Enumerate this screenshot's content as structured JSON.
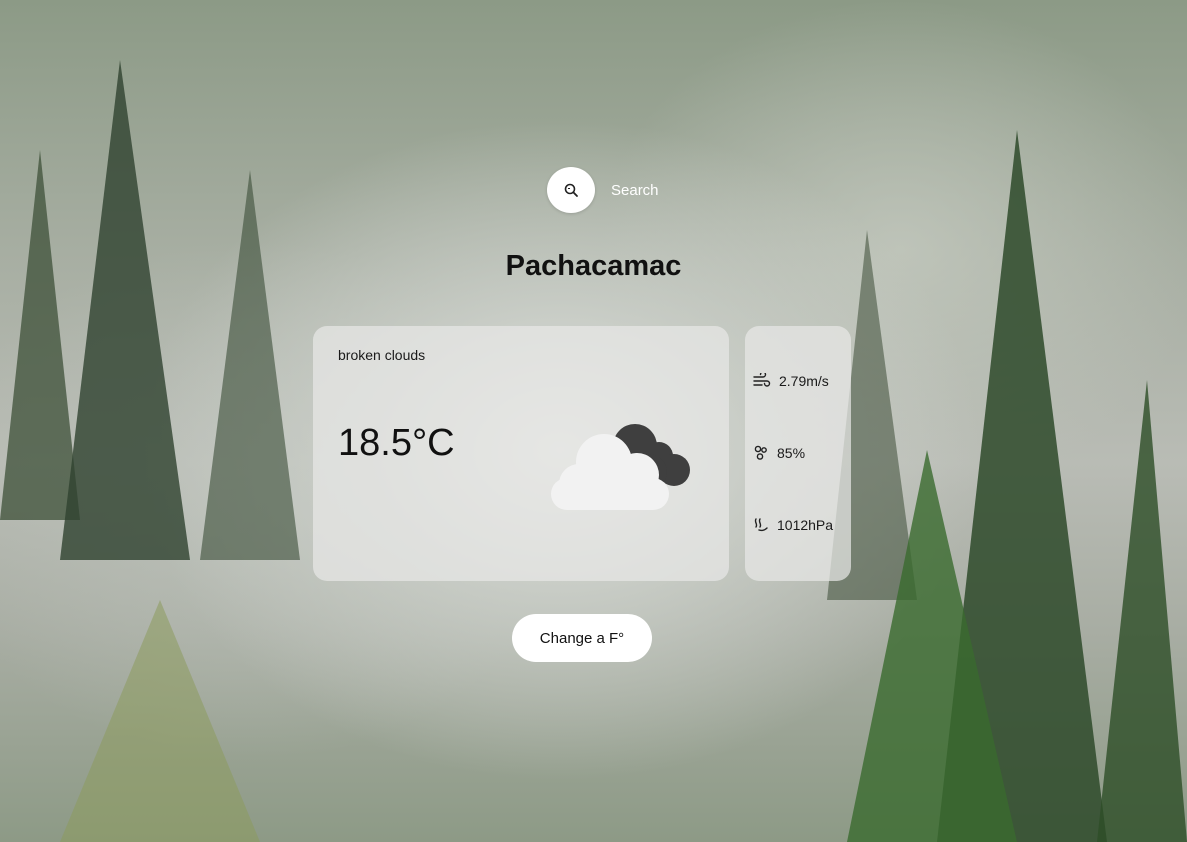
{
  "search": {
    "placeholder": "Search",
    "icon": "search-icon"
  },
  "city": "Pachacamac",
  "weather": {
    "description": "broken clouds",
    "temperature": "18.5°C",
    "icon": "broken-clouds-icon"
  },
  "details": {
    "wind": {
      "value": "2.79m/s",
      "icon": "wind-icon"
    },
    "humidity": {
      "value": "85%",
      "icon": "humidity-icon"
    },
    "pressure": {
      "value": "1012hPa",
      "icon": "pressure-icon"
    }
  },
  "unit_toggle": {
    "label": "Change a F°"
  }
}
